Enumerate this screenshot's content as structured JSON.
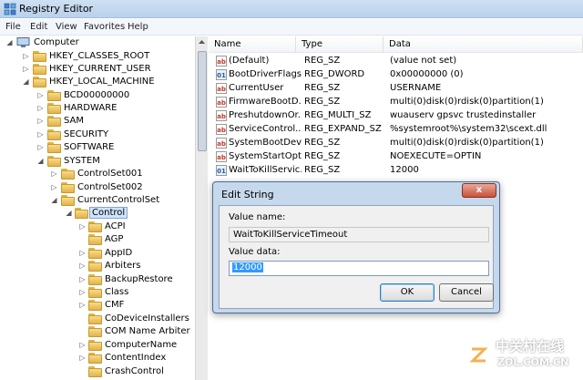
{
  "window": {
    "title": "Registry Editor"
  },
  "menu": [
    "File",
    "Edit",
    "View",
    "Favorites",
    "Help"
  ],
  "tree": [
    {
      "label": "Computer",
      "expanded": true
    },
    {
      "label": "HKEY_CLASSES_ROOT"
    },
    {
      "label": "HKEY_CURRENT_USER"
    },
    {
      "label": "HKEY_LOCAL_MACHINE",
      "expanded": true
    },
    {
      "label": "BCD00000000"
    },
    {
      "label": "HARDWARE"
    },
    {
      "label": "SAM"
    },
    {
      "label": "SECURITY"
    },
    {
      "label": "SOFTWARE"
    },
    {
      "label": "SYSTEM",
      "expanded": true
    },
    {
      "label": "ControlSet001"
    },
    {
      "label": "ControlSet002"
    },
    {
      "label": "CurrentControlSet",
      "expanded": true
    },
    {
      "label": "Control",
      "expanded": true,
      "selected": true
    },
    {
      "label": "ACPI"
    },
    {
      "label": "AGP"
    },
    {
      "label": "AppID"
    },
    {
      "label": "Arbiters"
    },
    {
      "label": "BackupRestore"
    },
    {
      "label": "Class"
    },
    {
      "label": "CMF"
    },
    {
      "label": "CoDeviceInstallers"
    },
    {
      "label": "COM Name Arbiter"
    },
    {
      "label": "ComputerName"
    },
    {
      "label": "ContentIndex"
    },
    {
      "label": "CrashControl"
    }
  ],
  "columns": {
    "name": "Name",
    "type": "Type",
    "data": "Data"
  },
  "values": [
    {
      "name": "(Default)",
      "type": "REG_SZ",
      "data": "(value not set)",
      "icon": "string-value-icon"
    },
    {
      "name": "BootDriverFlags",
      "type": "REG_DWORD",
      "data": "0x00000000 (0)",
      "icon": "binary-value-icon"
    },
    {
      "name": "CurrentUser",
      "type": "REG_SZ",
      "data": "USERNAME",
      "icon": "string-value-icon"
    },
    {
      "name": "FirmwareBootD...",
      "type": "REG_SZ",
      "data": "multi(0)disk(0)rdisk(0)partition(1)",
      "icon": "string-value-icon"
    },
    {
      "name": "PreshutdownOr...",
      "type": "REG_MULTI_SZ",
      "data": "wuauserv gpsvc trustedinstaller",
      "icon": "string-value-icon"
    },
    {
      "name": "ServiceControl...",
      "type": "REG_EXPAND_SZ",
      "data": "%systemroot%\\system32\\scext.dll",
      "icon": "string-value-icon"
    },
    {
      "name": "SystemBootDevi...",
      "type": "REG_SZ",
      "data": "multi(0)disk(0)rdisk(0)partition(1)",
      "icon": "string-value-icon"
    },
    {
      "name": "SystemStartOpti...",
      "type": "REG_SZ",
      "data": " NOEXECUTE=OPTIN",
      "icon": "string-value-icon"
    },
    {
      "name": "WaitToKillServic...",
      "type": "REG_SZ",
      "data": "12000",
      "icon": "binary-value-icon"
    }
  ],
  "dialog": {
    "title": "Edit String",
    "close_label": "x",
    "value_name_label": "Value name:",
    "value_name": "WaitToKillServiceTimeout",
    "value_data_label": "Value data:",
    "value_data": "12000",
    "ok_label": "OK",
    "cancel_label": "Cancel"
  },
  "watermark": {
    "chinese": "中关村在线",
    "domain": "ZOL.COM.CN"
  }
}
